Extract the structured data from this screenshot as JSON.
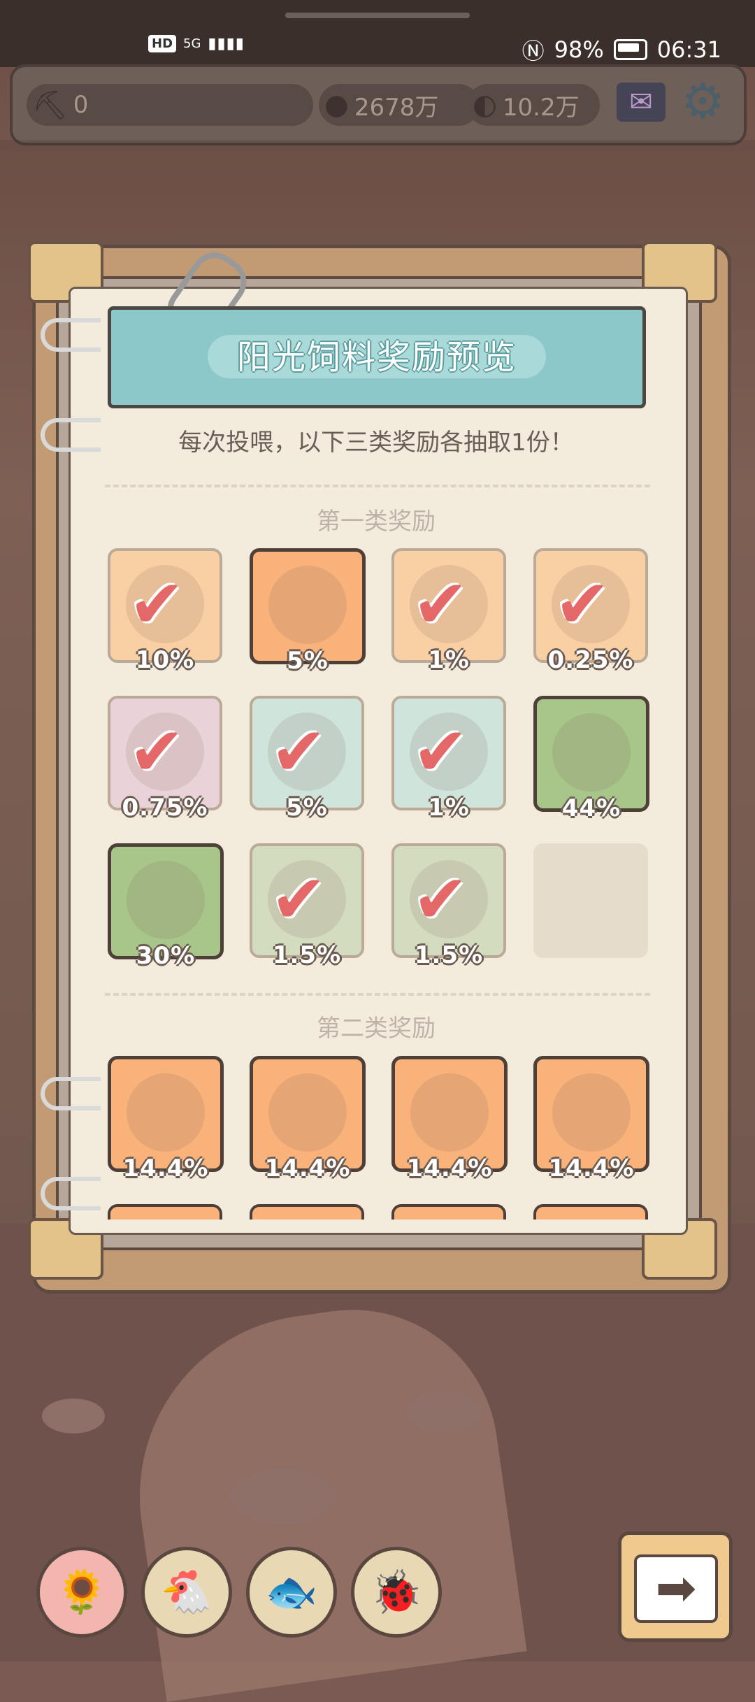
{
  "status_bar": {
    "network_hd": "HD",
    "network_gen": "5G",
    "signal": "▮▮▮▮",
    "battery": "98%",
    "time": "06:31"
  },
  "top_bar": {
    "pickaxe_value": "0",
    "resource_1": "2678万",
    "resource_2": "10.2万"
  },
  "panel": {
    "title": "阳光饲料奖励预览",
    "subtitle": "每次投喂，以下三类奖励各抽取1份！",
    "section1_title": "第一类奖励",
    "section2_title": "第二类奖励"
  },
  "section1_items": [
    {
      "pct": "10%",
      "color": "#f9d0a4",
      "owned": true
    },
    {
      "pct": "5%",
      "color": "#f9b27a",
      "owned": false
    },
    {
      "pct": "1%",
      "color": "#f9d0a4",
      "owned": true
    },
    {
      "pct": "0.25%",
      "color": "#f9d0a4",
      "owned": true
    },
    {
      "pct": "0.75%",
      "color": "#ead3d8",
      "owned": true
    },
    {
      "pct": "5%",
      "color": "#cfe4db",
      "owned": true
    },
    {
      "pct": "1%",
      "color": "#cfe4db",
      "owned": true
    },
    {
      "pct": "44%",
      "color": "#a8c58a",
      "owned": false
    },
    {
      "pct": "30%",
      "color": "#a8c58a",
      "owned": false
    },
    {
      "pct": "1.5%",
      "color": "#d4dcc0",
      "owned": true
    },
    {
      "pct": "1.5%",
      "color": "#d4dcc0",
      "owned": true
    }
  ],
  "section2_items": [
    {
      "pct": "14.4%",
      "color": "#f9b27a"
    },
    {
      "pct": "14.4%",
      "color": "#f9b27a"
    },
    {
      "pct": "14.4%",
      "color": "#f9b27a"
    },
    {
      "pct": "14.4%",
      "color": "#f9b27a"
    }
  ],
  "icons": {
    "check": "✔",
    "next": "➡"
  }
}
